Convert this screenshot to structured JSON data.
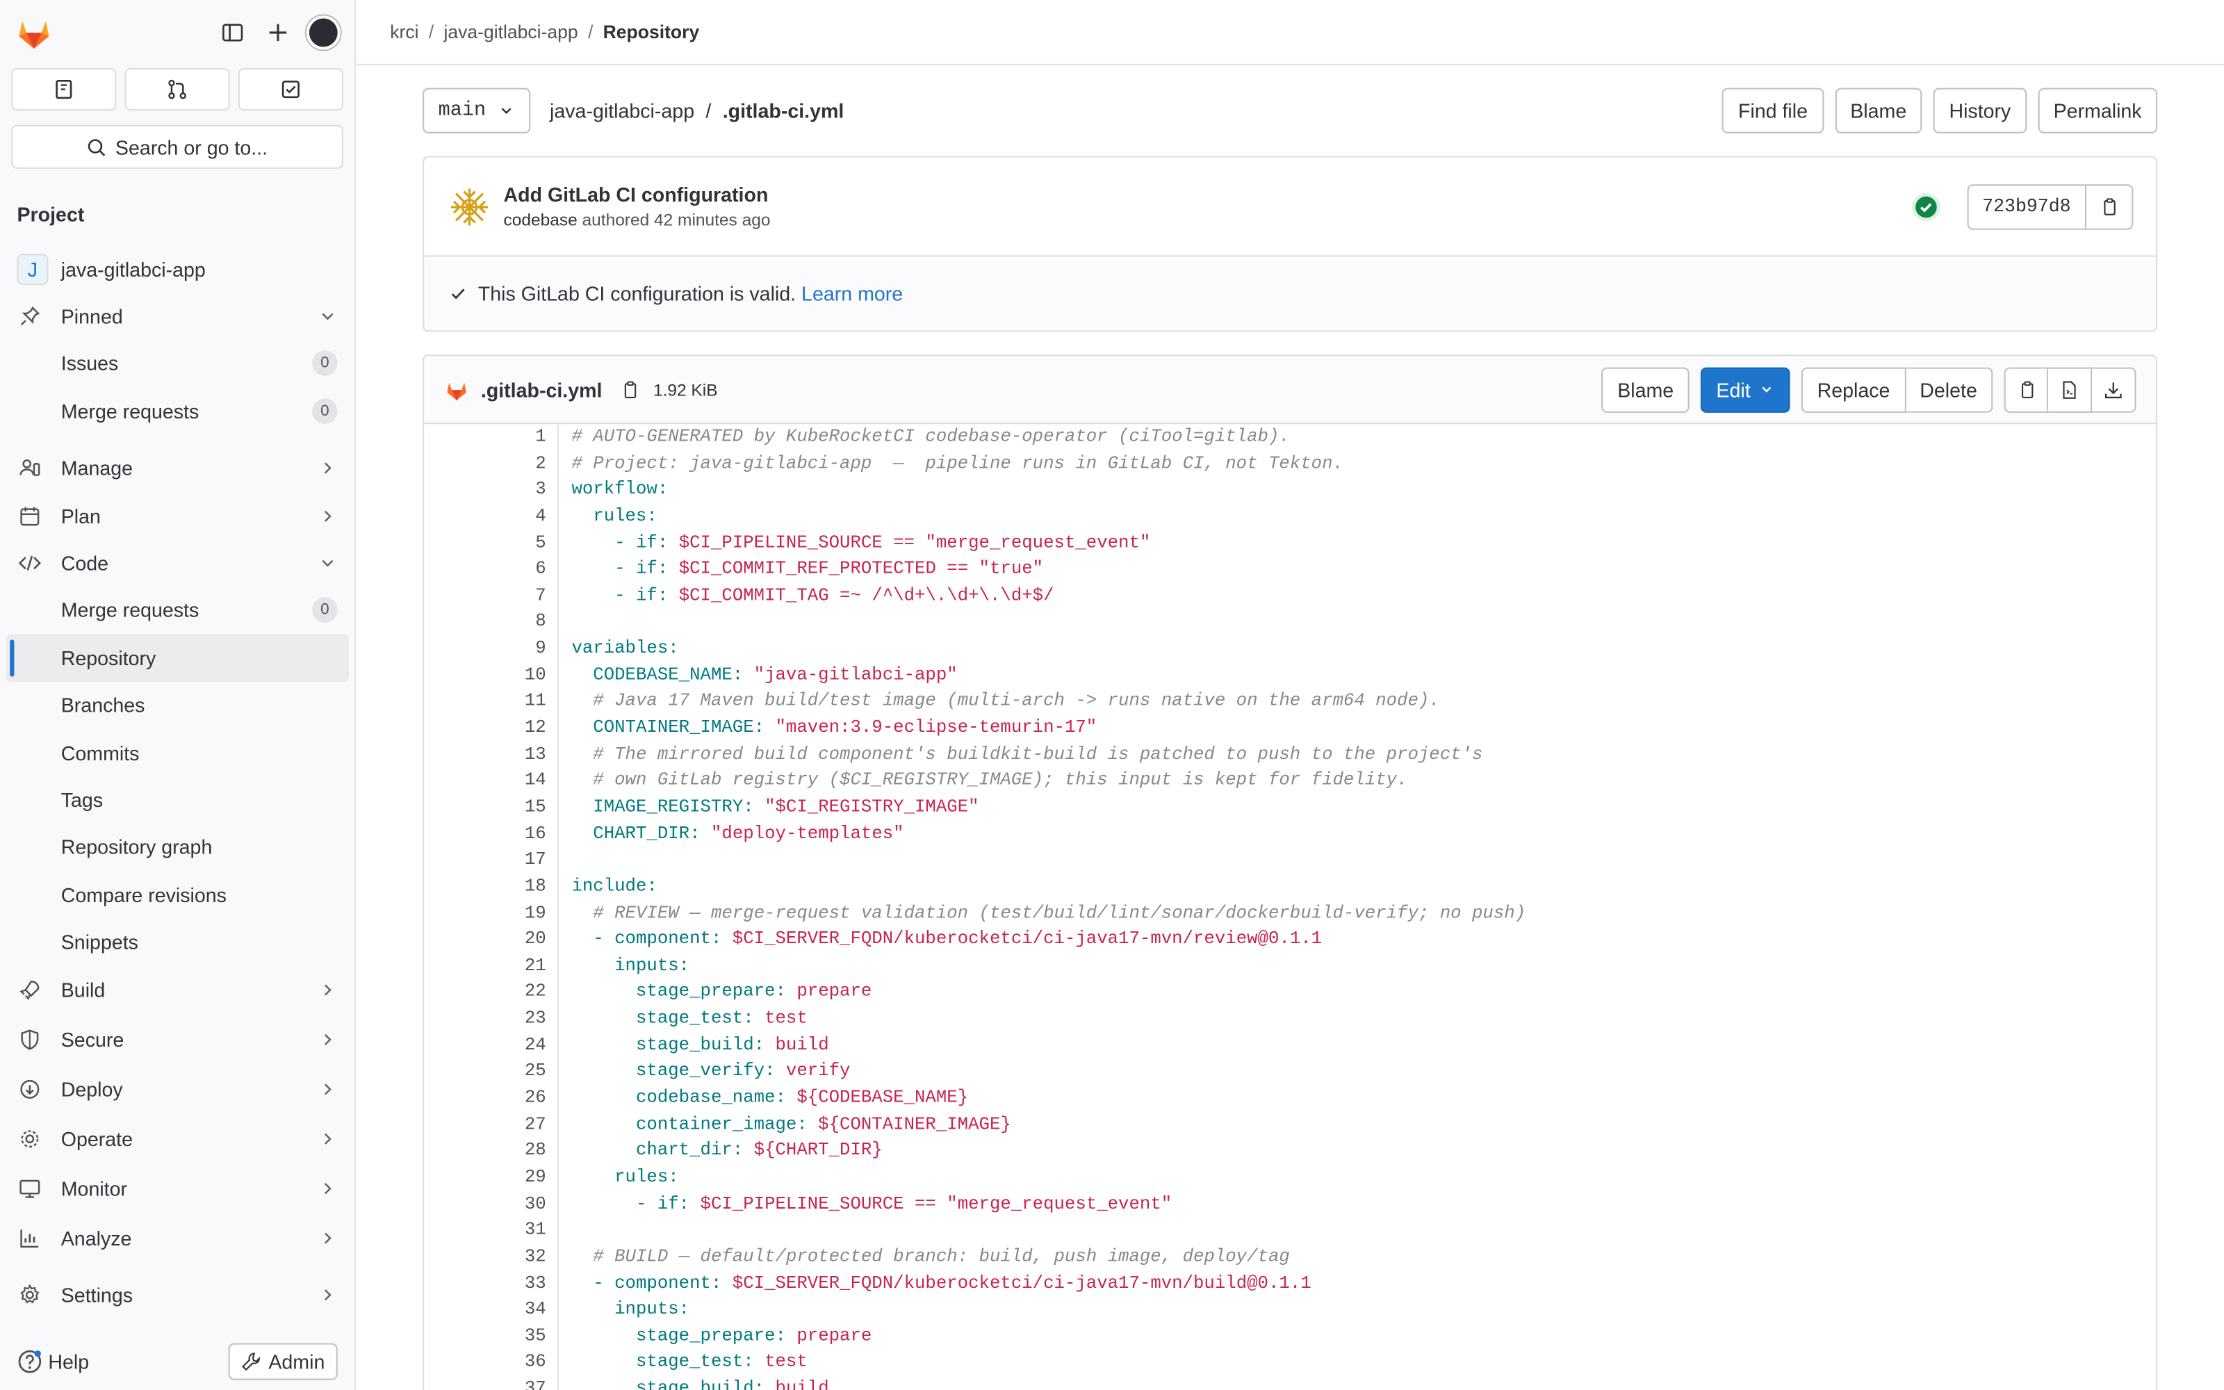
{
  "breadcrumb": [
    "krci",
    "java-gitlabci-app",
    "Repository"
  ],
  "sidebar": {
    "search_label": "Search or go to...",
    "section_title": "Project",
    "project_name": "java-gitlabci-app",
    "project_initial": "J",
    "pinned": {
      "label": "Pinned",
      "items": [
        {
          "label": "Issues",
          "count": "0"
        },
        {
          "label": "Merge requests",
          "count": "0"
        }
      ]
    },
    "groups": [
      {
        "label": "Manage",
        "icon": "users-icon"
      },
      {
        "label": "Plan",
        "icon": "calendar-icon"
      }
    ],
    "code": {
      "label": "Code",
      "items": [
        {
          "label": "Merge requests",
          "count": "0"
        },
        {
          "label": "Repository"
        },
        {
          "label": "Branches"
        },
        {
          "label": "Commits"
        },
        {
          "label": "Tags"
        },
        {
          "label": "Repository graph"
        },
        {
          "label": "Compare revisions"
        },
        {
          "label": "Snippets"
        }
      ]
    },
    "groups_after": [
      {
        "label": "Build"
      },
      {
        "label": "Secure"
      },
      {
        "label": "Deploy"
      },
      {
        "label": "Operate"
      },
      {
        "label": "Monitor"
      },
      {
        "label": "Analyze"
      }
    ],
    "settings_label": "Settings",
    "help_label": "Help",
    "admin_label": "Admin"
  },
  "toolbar": {
    "branch": "main",
    "project": "java-gitlabci-app",
    "path_sep": "/",
    "file": ".gitlab-ci.yml",
    "buttons": [
      "Find file",
      "Blame",
      "History",
      "Permalink"
    ]
  },
  "commit": {
    "title": "Add GitLab CI configuration",
    "author": "codebase",
    "authored": "authored 42 minutes ago",
    "sha": "723b97d8",
    "valid_text": "This GitLab CI configuration is valid.",
    "learn_more": "Learn more"
  },
  "file": {
    "name": ".gitlab-ci.yml",
    "size": "1.92 KiB",
    "blame": "Blame",
    "edit": "Edit",
    "replace": "Replace",
    "delete": "Delete",
    "lines": [
      "# AUTO-GENERATED by KubeRocketCI codebase-operator (ciTool=gitlab).",
      "# Project: java-gitlabci-app  —  pipeline runs in GitLab CI, not Tekton.",
      "workflow:",
      "  rules:",
      "    - if: $CI_PIPELINE_SOURCE == \"merge_request_event\"",
      "    - if: $CI_COMMIT_REF_PROTECTED == \"true\"",
      "    - if: $CI_COMMIT_TAG =~ /^\\d+\\.\\d+\\.\\d+$/",
      "",
      "variables:",
      "  CODEBASE_NAME: \"java-gitlabci-app\"",
      "  # Java 17 Maven build/test image (multi-arch -> runs native on the arm64 node).",
      "  CONTAINER_IMAGE: \"maven:3.9-eclipse-temurin-17\"",
      "  # The mirrored build component's buildkit-build is patched to push to the project's",
      "  # own GitLab registry ($CI_REGISTRY_IMAGE); this input is kept for fidelity.",
      "  IMAGE_REGISTRY: \"$CI_REGISTRY_IMAGE\"",
      "  CHART_DIR: \"deploy-templates\"",
      "",
      "include:",
      "  # REVIEW — merge-request validation (test/build/lint/sonar/dockerbuild-verify; no push)",
      "  - component: $CI_SERVER_FQDN/kuberocketci/ci-java17-mvn/review@0.1.1",
      "    inputs:",
      "      stage_prepare: prepare",
      "      stage_test: test",
      "      stage_build: build",
      "      stage_verify: verify",
      "      codebase_name: ${CODEBASE_NAME}",
      "      container_image: ${CONTAINER_IMAGE}",
      "      chart_dir: ${CHART_DIR}",
      "    rules:",
      "      - if: $CI_PIPELINE_SOURCE == \"merge_request_event\"",
      "",
      "  # BUILD — default/protected branch: build, push image, deploy/tag",
      "  - component: $CI_SERVER_FQDN/kuberocketci/ci-java17-mvn/build@0.1.1",
      "    inputs:",
      "      stage_prepare: prepare",
      "      stage_test: test",
      "      stage_build: build"
    ]
  }
}
